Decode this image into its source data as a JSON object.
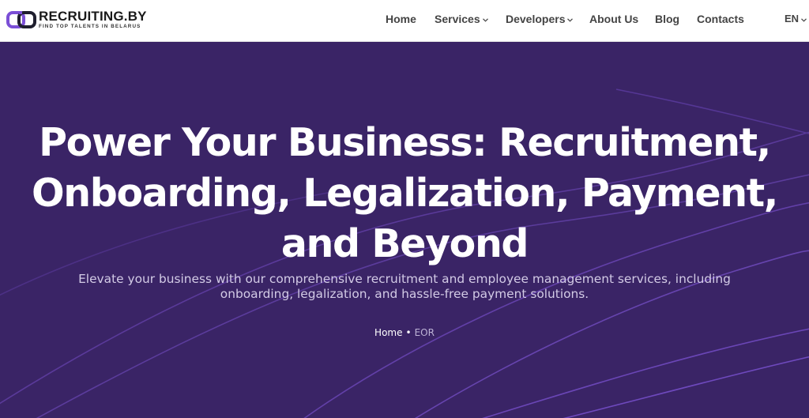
{
  "header": {
    "logo": {
      "name": "RECRUITING.BY",
      "tagline": "FIND TOP TALENTS IN BELARUS"
    },
    "nav": [
      {
        "label": "Home"
      },
      {
        "label": "Services"
      },
      {
        "label": "Developers"
      },
      {
        "label": "About Us"
      },
      {
        "label": "Blog"
      },
      {
        "label": "Contacts"
      }
    ],
    "language": "EN"
  },
  "hero": {
    "title_lines": [
      "Power Your Business: Recruitment,",
      "Onboarding, Legalization, Payment,",
      "and Beyond"
    ],
    "subtitle_lines": [
      "Elevate your business with our comprehensive recruitment and employee management services, including",
      "onboarding, legalization, and hassle-free payment solutions."
    ],
    "breadcrumb": {
      "home": "Home",
      "separator": "•",
      "current": "EOR"
    }
  },
  "colors": {
    "hero_background": "#3a2466",
    "accent": "#7b4fd6",
    "logo_purple": "#6a3fc9",
    "nav_text": "#444444"
  },
  "icons": {
    "logo": "chain-link-icon",
    "dropdown": "chevron-down-icon"
  }
}
